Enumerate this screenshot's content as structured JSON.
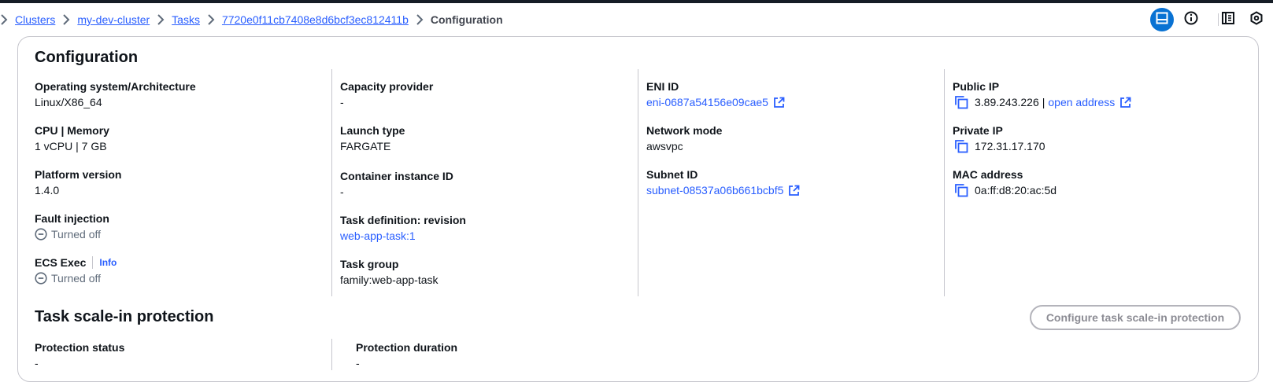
{
  "breadcrumbs": [
    {
      "label": "Clusters",
      "link": true
    },
    {
      "label": "my-dev-cluster",
      "link": true
    },
    {
      "label": "Tasks",
      "link": true
    },
    {
      "label": "7720e0f11cb7408e8d6bcf3ec812411b",
      "link": true
    },
    {
      "label": "Configuration",
      "link": false
    }
  ],
  "configuration": {
    "title": "Configuration",
    "col1": {
      "os_label": "Operating system/Architecture",
      "os_value": "Linux/X86_64",
      "cpu_label": "CPU | Memory",
      "cpu_value": "1 vCPU | 7 GB",
      "platform_label": "Platform version",
      "platform_value": "1.4.0",
      "fault_label": "Fault injection",
      "fault_value": "Turned off",
      "ecs_label": "ECS Exec",
      "ecs_info": "Info",
      "ecs_value": "Turned off"
    },
    "col2": {
      "capacity_label": "Capacity provider",
      "capacity_value": "-",
      "launch_label": "Launch type",
      "launch_value": "FARGATE",
      "container_label": "Container instance ID",
      "container_value": "-",
      "taskdef_label": "Task definition: revision",
      "taskdef_value": "web-app-task:1",
      "group_label": "Task group",
      "group_value": "family:web-app-task"
    },
    "col3": {
      "eni_label": "ENI ID",
      "eni_value": "eni-0687a54156e09cae5",
      "network_label": "Network mode",
      "network_value": "awsvpc",
      "subnet_label": "Subnet ID",
      "subnet_value": "subnet-08537a06b661bcbf5"
    },
    "col4": {
      "public_label": "Public IP",
      "public_value": "3.89.243.226",
      "public_sep": "|",
      "public_link": "open address",
      "private_label": "Private IP",
      "private_value": "172.31.17.170",
      "mac_label": "MAC address",
      "mac_value": "0a:ff:d8:20:ac:5d"
    }
  },
  "scale_in": {
    "title": "Task scale-in protection",
    "button": "Configure task scale-in protection",
    "status_label": "Protection status",
    "status_value": "-",
    "duration_label": "Protection duration",
    "duration_value": "-"
  },
  "colors": {
    "link": "#295eff",
    "active_tool": "#0972d3",
    "border": "#c6c6cd",
    "topbar": "#161d26"
  },
  "icons": [
    "chevron-right-icon",
    "split-panel-icon",
    "info-icon",
    "notes-icon",
    "settings-icon",
    "external-link-icon",
    "copy-icon",
    "status-stopped-icon"
  ]
}
